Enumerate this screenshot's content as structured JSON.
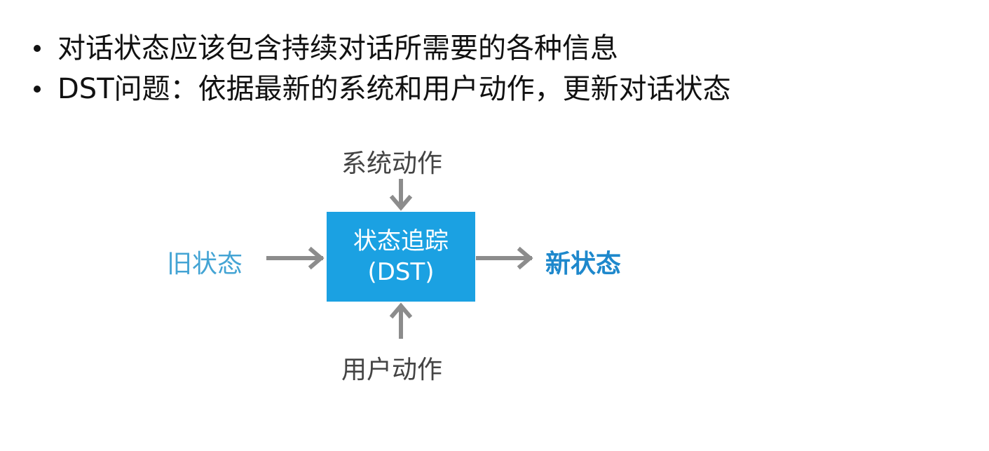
{
  "bullets": [
    "对话状态应该包含持续对话所需要的各种信息",
    "DST问题：依据最新的系统和用户动作，更新对话状态"
  ],
  "diagram": {
    "center_line1": "状态追踪",
    "center_line2": "(DST)",
    "top_input": "系统动作",
    "bottom_input": "用户动作",
    "left_input": "旧状态",
    "right_output": "新状态",
    "colors": {
      "box": "#1ba1e2",
      "arrow": "#8c8c8c",
      "old_state": "#44a4d4",
      "new_state": "#1e88cc"
    }
  }
}
